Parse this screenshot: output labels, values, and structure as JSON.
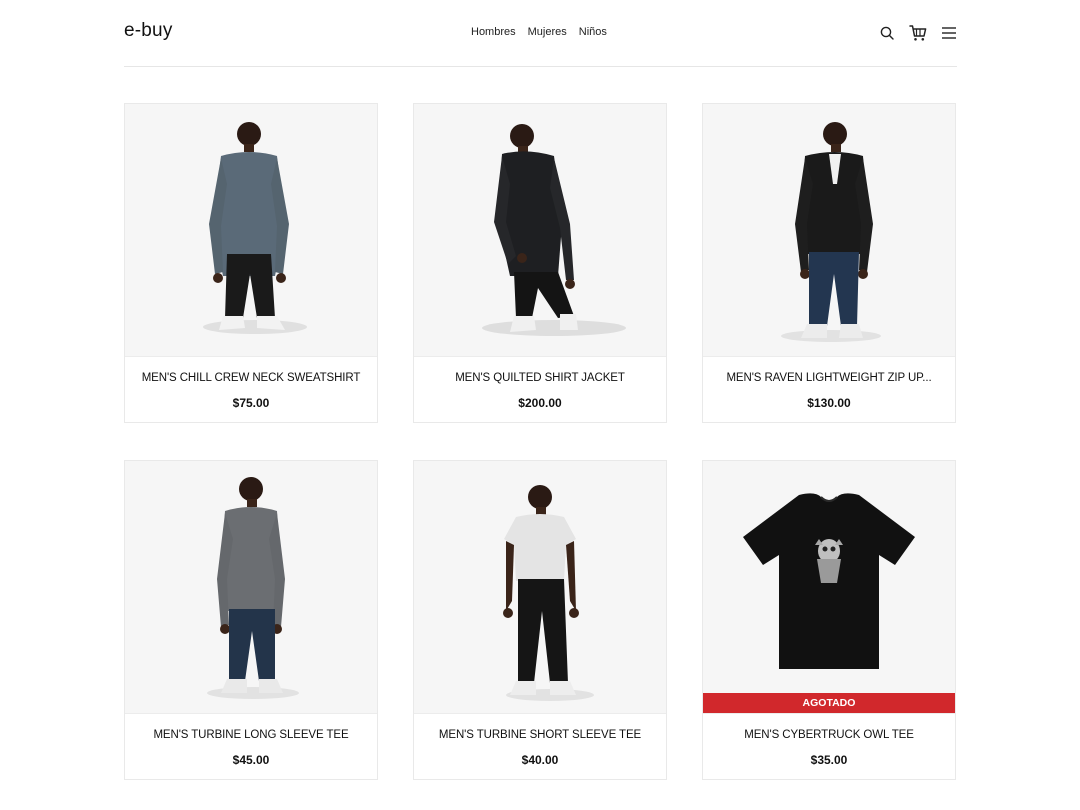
{
  "brand": {
    "logo_text": "e-buy"
  },
  "nav": {
    "items": [
      {
        "label": "Hombres"
      },
      {
        "label": "Mujeres"
      },
      {
        "label": "Niños"
      }
    ]
  },
  "header_icons": [
    "search-icon",
    "cart-icon",
    "menu-icon"
  ],
  "products": [
    {
      "title": "MEN'S CHILL CREW NECK SWEATSHIRT",
      "price": "$75.00",
      "image": "model-gray-sweatshirt"
    },
    {
      "title": "MEN'S QUILTED SHIRT JACKET",
      "price": "$200.00",
      "image": "model-black-jacket"
    },
    {
      "title": "MEN'S RAVEN LIGHTWEIGHT ZIP UP...",
      "price": "$130.00",
      "image": "model-black-zip-cardigan"
    },
    {
      "title": "MEN'S TURBINE LONG SLEEVE TEE",
      "price": "$45.00",
      "image": "model-gray-long-sleeve"
    },
    {
      "title": "MEN'S TURBINE SHORT SLEEVE TEE",
      "price": "$40.00",
      "image": "model-white-tee"
    },
    {
      "title": "MEN'S CYBERTRUCK OWL TEE",
      "price": "$35.00",
      "image": "black-owl-tshirt",
      "badge": "AGOTADO"
    }
  ],
  "colors": {
    "badge_bg": "#d1282c",
    "photo_bg": "#f6f6f6",
    "text": "#111111"
  }
}
